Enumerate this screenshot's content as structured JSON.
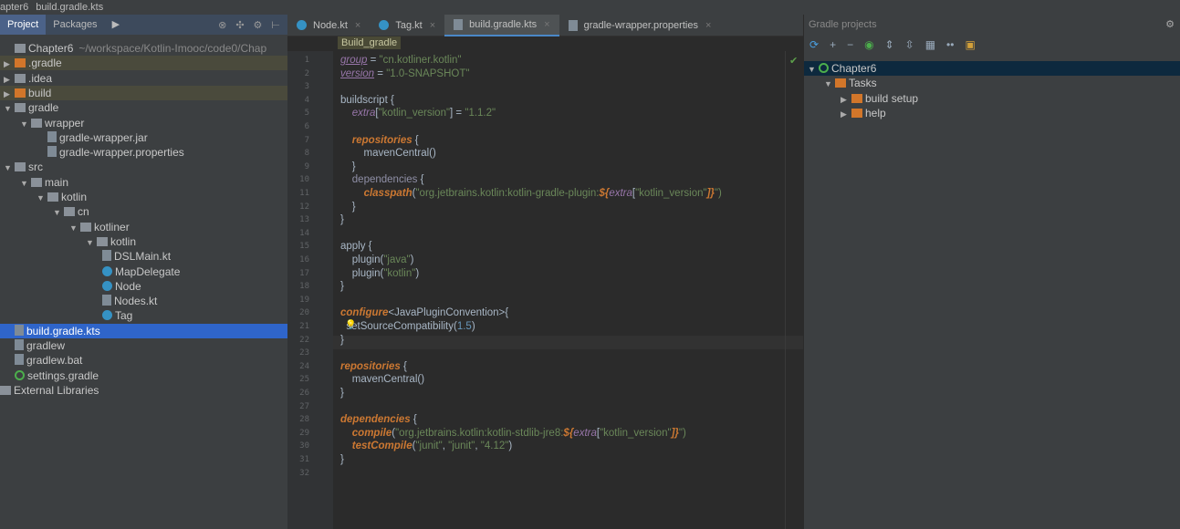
{
  "topbar": {
    "project": "apter6",
    "file": "build.gradle.kts"
  },
  "left": {
    "tabs": [
      "Project",
      "Packages"
    ],
    "tree": [
      {
        "label": "Chapter6",
        "extra": "~/workspace/Kotlin-Imooc/code0/Chap",
        "depth": 0,
        "arrow": "",
        "icon": "module"
      },
      {
        "label": ".gradle",
        "depth": 0,
        "arrow": "▶",
        "icon": "folder-orange",
        "hl": true
      },
      {
        "label": ".idea",
        "depth": 0,
        "arrow": "▶",
        "icon": "folder"
      },
      {
        "label": "build",
        "depth": 0,
        "arrow": "▶",
        "icon": "folder-orange",
        "hl": true
      },
      {
        "label": "gradle",
        "depth": 0,
        "arrow": "▼",
        "icon": "folder"
      },
      {
        "label": "wrapper",
        "depth": 1,
        "arrow": "▼",
        "icon": "folder"
      },
      {
        "label": "gradle-wrapper.jar",
        "depth": 2,
        "arrow": "",
        "icon": "jar"
      },
      {
        "label": "gradle-wrapper.properties",
        "depth": 2,
        "arrow": "",
        "icon": "file"
      },
      {
        "label": "src",
        "depth": 0,
        "arrow": "▼",
        "icon": "folder"
      },
      {
        "label": "main",
        "depth": 1,
        "arrow": "▼",
        "icon": "folder"
      },
      {
        "label": "kotlin",
        "depth": 2,
        "arrow": "▼",
        "icon": "folder"
      },
      {
        "label": "cn",
        "depth": 3,
        "arrow": "▼",
        "icon": "folder"
      },
      {
        "label": "kotliner",
        "depth": 4,
        "arrow": "▼",
        "icon": "folder"
      },
      {
        "label": "kotlin",
        "depth": 5,
        "arrow": "▼",
        "icon": "folder"
      },
      {
        "label": "DSLMain.kt",
        "depth": 6,
        "arrow": "",
        "icon": "file"
      },
      {
        "label": "MapDelegate",
        "depth": 6,
        "arrow": "",
        "icon": "class"
      },
      {
        "label": "Node",
        "depth": 6,
        "arrow": "",
        "icon": "class"
      },
      {
        "label": "Nodes.kt",
        "depth": 6,
        "arrow": "",
        "icon": "file"
      },
      {
        "label": "Tag",
        "depth": 6,
        "arrow": "",
        "icon": "class"
      },
      {
        "label": "build.gradle.kts",
        "depth": 0,
        "arrow": "",
        "icon": "file",
        "sel": true
      },
      {
        "label": "gradlew",
        "depth": 0,
        "arrow": "",
        "icon": "file"
      },
      {
        "label": "gradlew.bat",
        "depth": 0,
        "arrow": "",
        "icon": "file"
      },
      {
        "label": "settings.gradle",
        "depth": 0,
        "arrow": "",
        "icon": "gradle"
      },
      {
        "label": "External Libraries",
        "depth": -1,
        "arrow": "",
        "icon": "libraries"
      }
    ]
  },
  "editor": {
    "tabs": [
      {
        "label": "Node.kt"
      },
      {
        "label": "Tag.kt"
      },
      {
        "label": "build.gradle.kts",
        "active": true
      },
      {
        "label": "gradle-wrapper.properties"
      }
    ],
    "breadcrumb": "Build_gradle",
    "cursor_line": 22,
    "lines": [
      [
        [
          "group",
          "pu"
        ],
        [
          " = ",
          "t"
        ],
        [
          "\"cn.kotliner.kotlin\"",
          "s"
        ]
      ],
      [
        [
          "version",
          "pu"
        ],
        [
          " = ",
          "t"
        ],
        [
          "\"1.0-SNAPSHOT\"",
          "s"
        ]
      ],
      [],
      [
        [
          "buildscript {",
          "t"
        ]
      ],
      [
        [
          "    ",
          "t"
        ],
        [
          "extra",
          "p"
        ],
        [
          "[",
          "t"
        ],
        [
          "\"kotlin_version\"",
          "s"
        ],
        [
          "] = ",
          "t"
        ],
        [
          "\"1.1.2\"",
          "s"
        ]
      ],
      [],
      [
        [
          "    ",
          "t"
        ],
        [
          "repositories",
          "k"
        ],
        [
          " {",
          "t"
        ]
      ],
      [
        [
          "        mavenCentral()",
          "t"
        ]
      ],
      [
        [
          "    }",
          "t"
        ]
      ],
      [
        [
          "    ",
          "t"
        ],
        [
          "dependencies",
          "g"
        ],
        [
          " {",
          "t"
        ]
      ],
      [
        [
          "        ",
          "t"
        ],
        [
          "classpath",
          "k"
        ],
        [
          "(",
          "t"
        ],
        [
          "\"org.jetbrains.kotlin:kotlin-gradle-plugin:",
          "s"
        ],
        [
          "${",
          "k"
        ],
        [
          "extra",
          "p"
        ],
        [
          "[",
          "t"
        ],
        [
          "\"kotlin_version\"",
          "s"
        ],
        [
          "]}",
          "k"
        ],
        [
          "\")",
          "s"
        ]
      ],
      [
        [
          "    }",
          "t"
        ]
      ],
      [
        [
          "}",
          "t"
        ]
      ],
      [],
      [
        [
          "apply {",
          "t"
        ]
      ],
      [
        [
          "    plugin(",
          "t"
        ],
        [
          "\"java\"",
          "s"
        ],
        [
          ")",
          "t"
        ]
      ],
      [
        [
          "    plugin(",
          "t"
        ],
        [
          "\"kotlin\"",
          "s"
        ],
        [
          ")",
          "t"
        ]
      ],
      [
        [
          "}",
          "t"
        ]
      ],
      [],
      [
        [
          "configure",
          "k"
        ],
        [
          "<JavaPluginConvention>{",
          "t"
        ]
      ],
      [
        [
          "  setSourceCompatibility(",
          "t"
        ],
        [
          "1.5",
          "n"
        ],
        [
          ")",
          "t"
        ]
      ],
      [
        [
          "}",
          "t"
        ]
      ],
      [],
      [
        [
          "repositories",
          "k"
        ],
        [
          " {",
          "t"
        ]
      ],
      [
        [
          "    mavenCentral()",
          "t"
        ]
      ],
      [
        [
          "}",
          "t"
        ]
      ],
      [],
      [
        [
          "dependencies",
          "k"
        ],
        [
          " {",
          "t"
        ]
      ],
      [
        [
          "    ",
          "t"
        ],
        [
          "compile",
          "k"
        ],
        [
          "(",
          "t"
        ],
        [
          "\"org.jetbrains.kotlin:kotlin-stdlib-jre8:",
          "s"
        ],
        [
          "${",
          "k"
        ],
        [
          "extra",
          "p"
        ],
        [
          "[",
          "t"
        ],
        [
          "\"kotlin_version\"",
          "s"
        ],
        [
          "]}",
          "k"
        ],
        [
          "\")",
          "s"
        ]
      ],
      [
        [
          "    ",
          "t"
        ],
        [
          "testCompile",
          "k"
        ],
        [
          "(",
          "t"
        ],
        [
          "\"junit\"",
          "s"
        ],
        [
          ", ",
          "t"
        ],
        [
          "\"junit\"",
          "s"
        ],
        [
          ", ",
          "t"
        ],
        [
          "\"4.12\"",
          "s"
        ],
        [
          ")",
          "t"
        ]
      ],
      [
        [
          "}",
          "t"
        ]
      ],
      []
    ]
  },
  "right": {
    "title": "Gradle projects",
    "toolbar": [
      "refresh-icon",
      "add-icon",
      "remove-icon",
      "gradle-icon",
      "expand-all-icon",
      "collapse-all-icon",
      "group-icon",
      "link-icon",
      "settings-icon"
    ],
    "tree": [
      {
        "label": "Chapter6",
        "depth": 0,
        "arrow": "▼",
        "sel": true
      },
      {
        "label": "Tasks",
        "depth": 1,
        "arrow": "▼"
      },
      {
        "label": "build setup",
        "depth": 2,
        "arrow": "▶"
      },
      {
        "label": "help",
        "depth": 2,
        "arrow": "▶"
      }
    ]
  },
  "colors": {
    "selection": "#2f65ca",
    "accent": "#4a88c7",
    "keyword": "#cc7832",
    "string": "#6a8759"
  }
}
